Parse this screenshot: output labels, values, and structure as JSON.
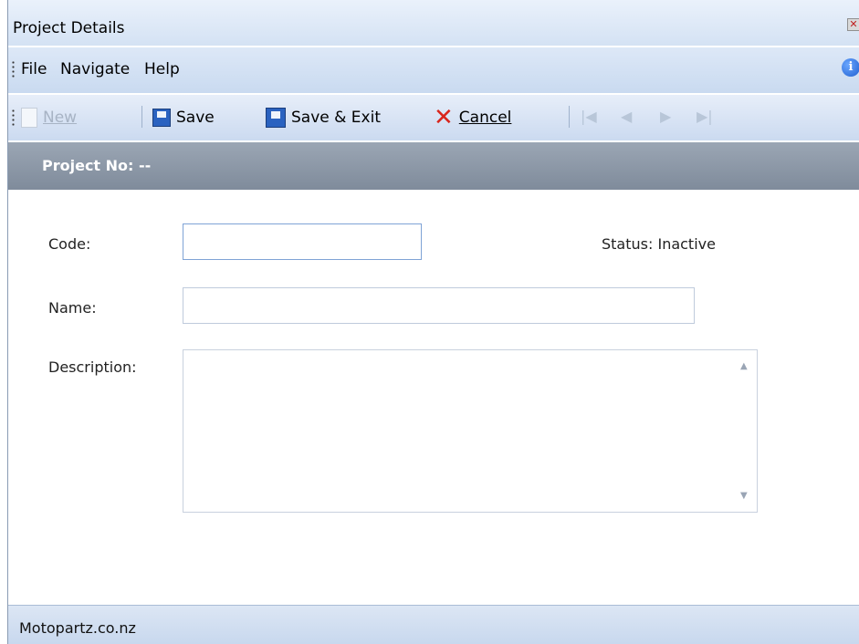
{
  "window": {
    "title": "Project Details"
  },
  "menu": {
    "items": [
      "File",
      "Navigate",
      "Help"
    ]
  },
  "toolbar": {
    "new_label": "New",
    "save_label": "Save",
    "save_exit_label": "Save & Exit",
    "cancel_label": "Cancel"
  },
  "header": {
    "label": "Project No:",
    "value": "--"
  },
  "form": {
    "code_label": "Code:",
    "code_value": "",
    "name_label": "Name:",
    "name_value": "",
    "description_label": "Description:",
    "description_value": "",
    "status_label": "Status:",
    "status_value": "Inactive"
  },
  "statusbar": {
    "text": "Motopartz.co.nz"
  }
}
